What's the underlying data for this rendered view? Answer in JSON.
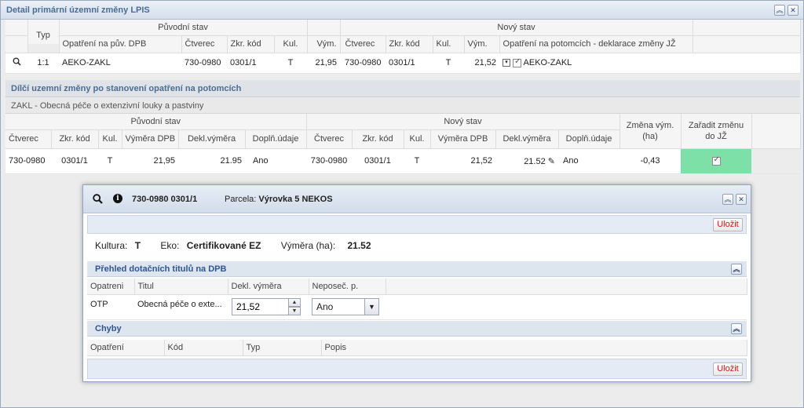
{
  "window": {
    "title": "Detail primární územní změny LPIS"
  },
  "top_table": {
    "group_headers": {
      "original": "Původní stav",
      "new": "Nový stav"
    },
    "headers": [
      "Typ",
      "Opatření na pův. DPB",
      "Čtverec",
      "Zkr. kód",
      "Kul.",
      "Vým.",
      "Čtverec",
      "Zkr. kód",
      "Kul.",
      "Vým.",
      "Opatření na potomcích - deklarace změny JŽ"
    ],
    "row": {
      "typ": "1:1",
      "opatreni": "AEKO-ZAKL",
      "ctverec": "730-0980",
      "zkr_kod": "0301/1",
      "kul": "T",
      "vym": "21,95",
      "new_ctverec": "730-0980",
      "new_zkr_kod": "0301/1",
      "new_kul": "T",
      "new_vym": "21,52",
      "new_opatreni": "AEKO-ZAKL"
    }
  },
  "partial_section": {
    "title": "Dílčí uzemní změny po stanovení opatření na potomcích",
    "subtitle": "ZAKL - Obecná péče o extenzivní louky a pastviny"
  },
  "second_table": {
    "group_headers": {
      "original": "Původní stav",
      "new": "Nový stav"
    },
    "headers": [
      "Čtverec",
      "Zkr. kód",
      "Kul.",
      "Výměra DPB",
      "Dekl.výměra",
      "Doplň.údaje",
      "Čtverec",
      "Zkr. kód",
      "Kul.",
      "Výměra DPB",
      "Dekl.výměra",
      "Doplň.údaje"
    ],
    "change_header_1": "Změna vým.",
    "change_header_2": "(ha)",
    "assign_header_1": "Zařadit změnu",
    "assign_header_2": "do JŽ",
    "row": {
      "ctverec": "730-0980",
      "zkr_kod": "0301/1",
      "kul": "T",
      "vymera_dpb": "21,95",
      "dekl": "21.95",
      "dopln": "Ano",
      "new_ctverec": "730-0980",
      "new_zkr_kod": "0301/1",
      "new_kul": "T",
      "new_vymera_dpb": "21,52",
      "new_dekl": "21.52",
      "new_dopln": "Ano",
      "zmena": "-0,43"
    }
  },
  "popup": {
    "block_code": "730-0980 0301/1",
    "parcel_label": "Parcela:",
    "parcel_value": "Výrovka 5 NEKOS",
    "save_label": "Uložit",
    "kultura_label": "Kultura:",
    "kultura_value": "T",
    "eko_label": "Eko:",
    "eko_value": "Certifikované EZ",
    "vymera_label": "Výměra (ha):",
    "vymera_value": "21.52",
    "titles_section": "Přehled dotačních titulů na DPB",
    "titles_headers": [
      "Opatreni",
      "Titul",
      "Dekl. výměra",
      "Neposeč. p."
    ],
    "titles_row": {
      "opatreni": "OTP",
      "titul": "Obecná péče o exte...",
      "dekl": "21,52",
      "neposec": "Ano"
    },
    "errors_section": "Chyby",
    "errors_headers": [
      "Opatření",
      "Kód",
      "Typ",
      "Popis"
    ]
  },
  "icons": {
    "search": "search-icon",
    "info": "info-icon",
    "pencil": "pencil-icon",
    "collapse": "collapse-icon",
    "close": "close-icon"
  },
  "colors": {
    "header_text": "#4a6c95",
    "assign_cell": "#7de0a6",
    "save_text": "#dd1111"
  }
}
